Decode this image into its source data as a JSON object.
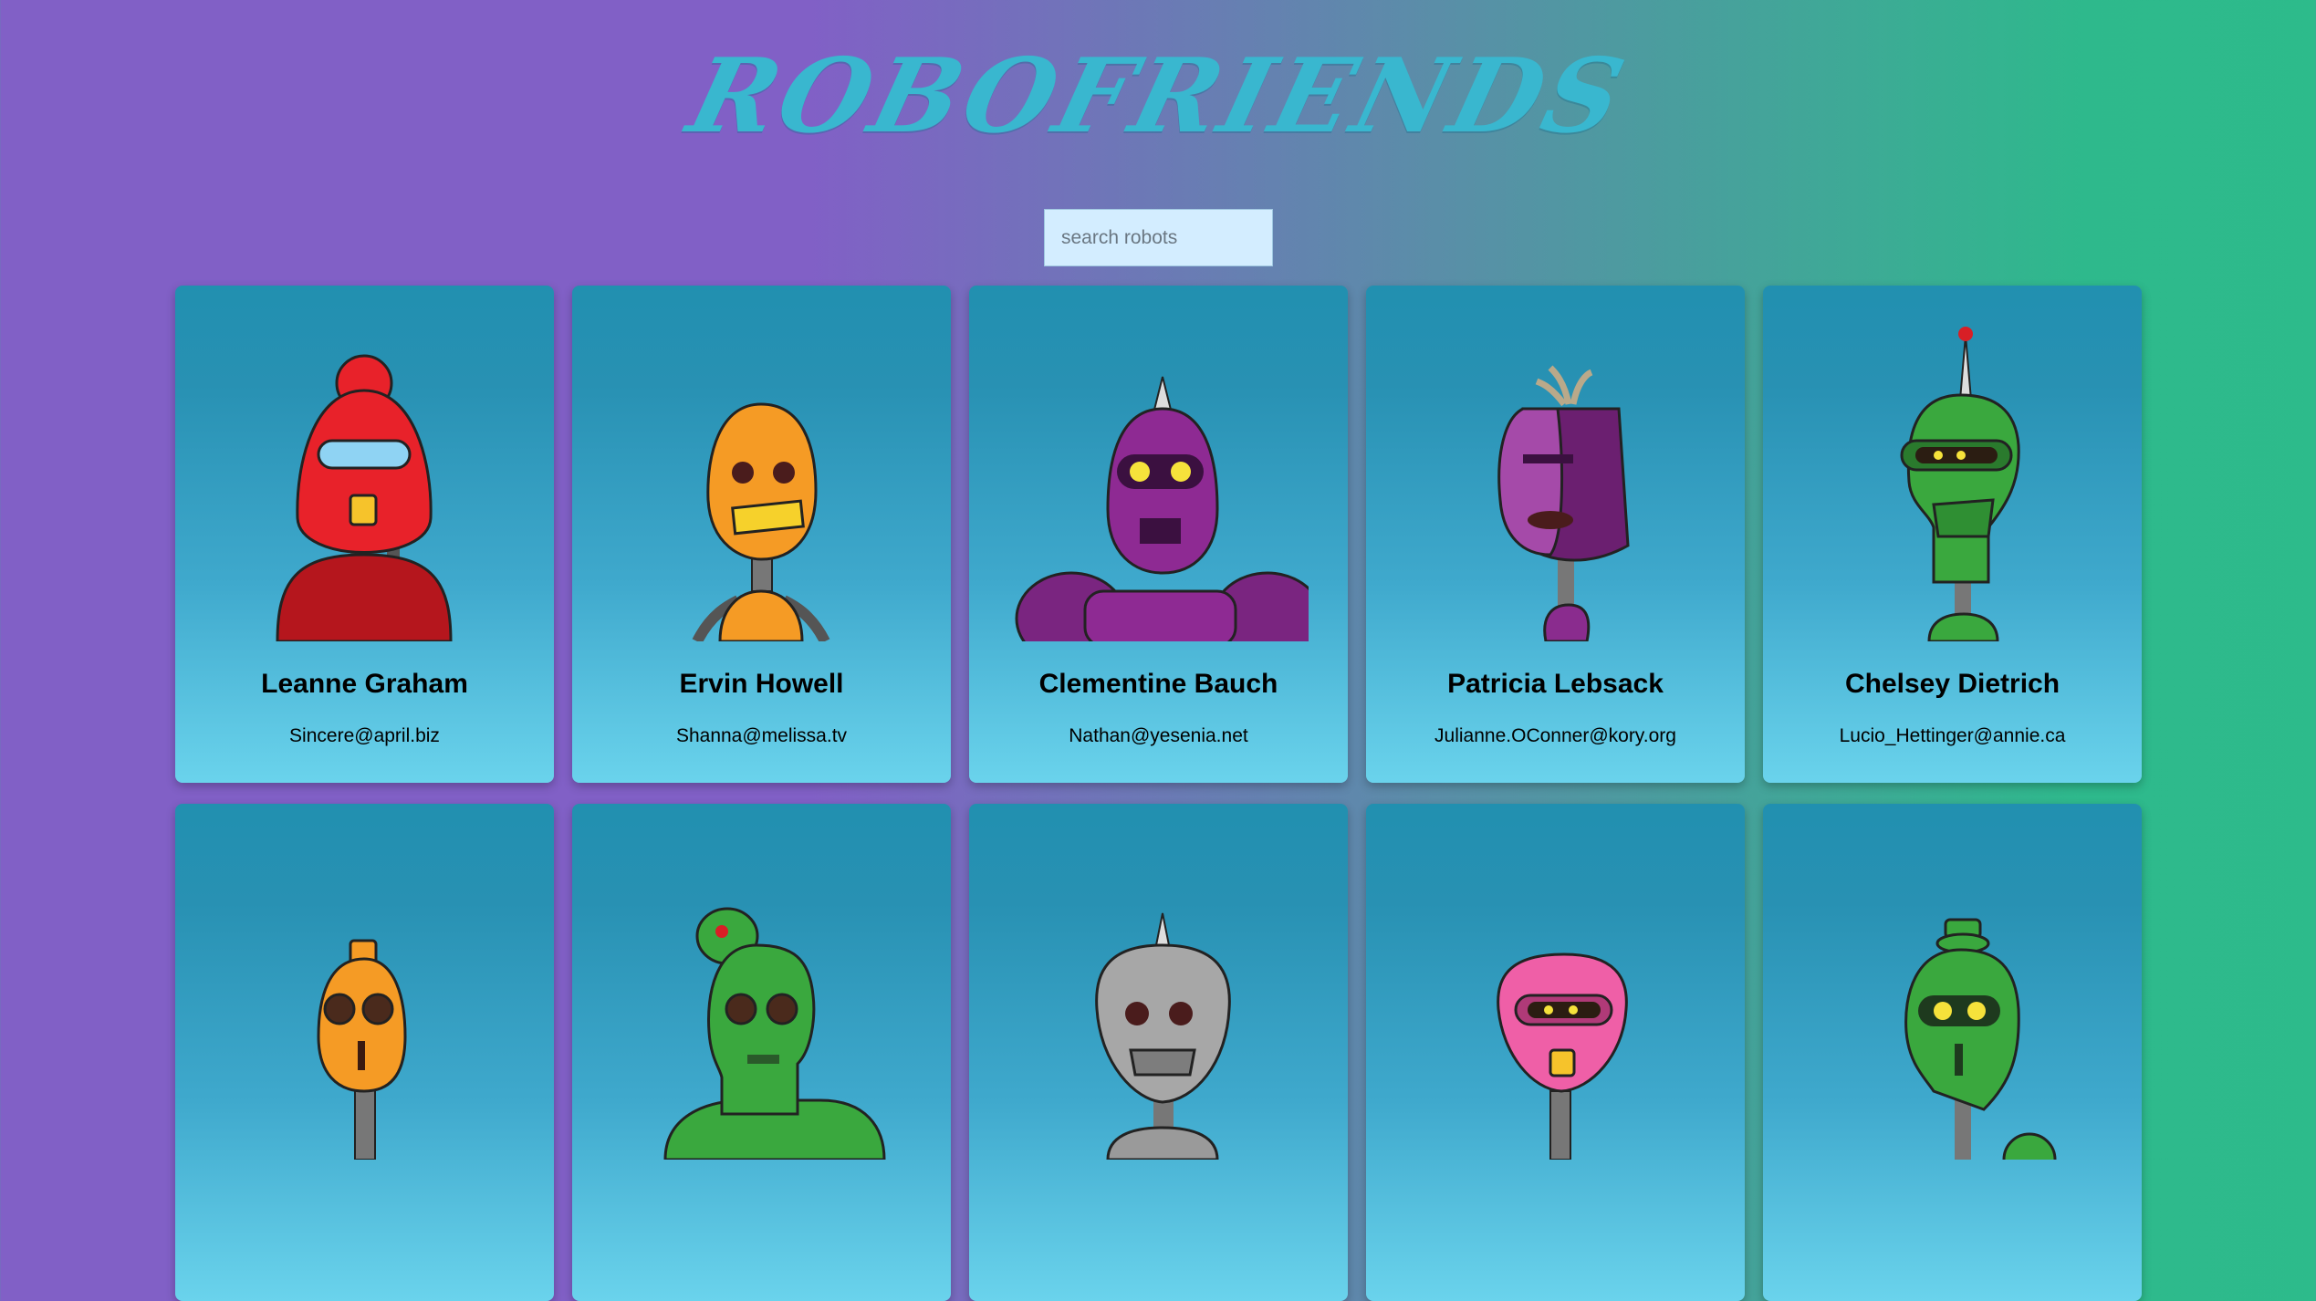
{
  "header": {
    "title": "ROBOFRIENDS"
  },
  "search": {
    "placeholder": "search robots",
    "value": ""
  },
  "robots": [
    {
      "name": "Leanne Graham",
      "email": "Sincere@april.biz",
      "color": "#e8222a"
    },
    {
      "name": "Ervin Howell",
      "email": "Shanna@melissa.tv",
      "color": "#f59b25"
    },
    {
      "name": "Clementine Bauch",
      "email": "Nathan@yesenia.net",
      "color": "#8e2a93"
    },
    {
      "name": "Patricia Lebsack",
      "email": "Julianne.OConner@kory.org",
      "color": "#8a2c8e"
    },
    {
      "name": "Chelsey Dietrich",
      "email": "Lucio_Hettinger@annie.ca",
      "color": "#3aa83e"
    },
    {
      "name": "",
      "email": "",
      "color": "#f59b25"
    },
    {
      "name": "",
      "email": "",
      "color": "#3aa83e"
    },
    {
      "name": "",
      "email": "",
      "color": "#9a9a9a"
    },
    {
      "name": "",
      "email": "",
      "color": "#ef5fa7"
    },
    {
      "name": "",
      "email": "",
      "color": "#3aa83e"
    }
  ]
}
